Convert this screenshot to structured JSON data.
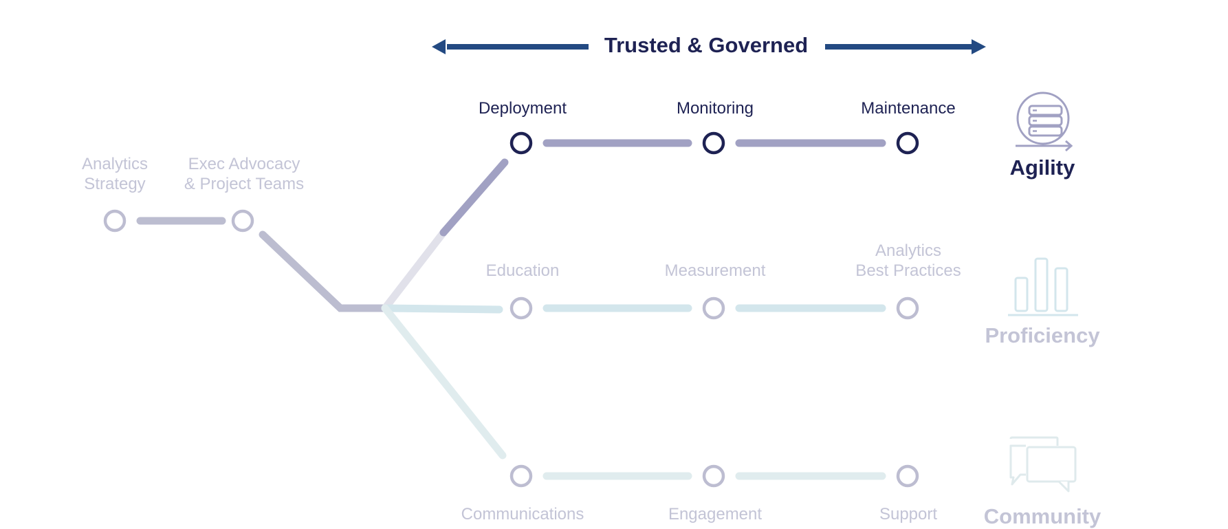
{
  "header": {
    "title": "Trusted & Governed",
    "arrow_color": "#234a82",
    "left_arrow_icon": "arrow-left-icon",
    "right_arrow_icon": "arrow-right-icon"
  },
  "colors": {
    "active_text": "#1e2253",
    "dim_text": "#c3c4d6",
    "active_node": "#1e2253",
    "dim_node": "#bdbdd1",
    "agility_line": "#a1a1c3",
    "prelude_line": "#bcbdd0",
    "agility_faded_line": "#e1e1ea",
    "proficiency_line": "#d3e6ec",
    "community_line": "#e0ecee",
    "proficiency_icon": "#d3e6ec",
    "community_icon": "#dfeaec"
  },
  "prelude": {
    "nodes": [
      {
        "label_lines": [
          "Analytics",
          "Strategy"
        ]
      },
      {
        "label_lines": [
          "Exec Advocacy",
          "& Project Teams"
        ]
      }
    ]
  },
  "tracks": [
    {
      "id": "agility",
      "category": "Agility",
      "icon": "database-cycle-icon",
      "state": "active",
      "nodes": [
        {
          "label_lines": [
            "Deployment"
          ]
        },
        {
          "label_lines": [
            "Monitoring"
          ]
        },
        {
          "label_lines": [
            "Maintenance"
          ]
        }
      ]
    },
    {
      "id": "proficiency",
      "category": "Proficiency",
      "icon": "bar-chart-icon",
      "state": "dim",
      "nodes": [
        {
          "label_lines": [
            "Education"
          ]
        },
        {
          "label_lines": [
            "Measurement"
          ]
        },
        {
          "label_lines": [
            "Analytics",
            "Best Practices"
          ]
        }
      ]
    },
    {
      "id": "community",
      "category": "Community",
      "icon": "chat-bubbles-icon",
      "state": "dim",
      "nodes": [
        {
          "label_lines": [
            "Communications"
          ]
        },
        {
          "label_lines": [
            "Engagement"
          ]
        },
        {
          "label_lines": [
            "Support"
          ]
        }
      ]
    }
  ]
}
